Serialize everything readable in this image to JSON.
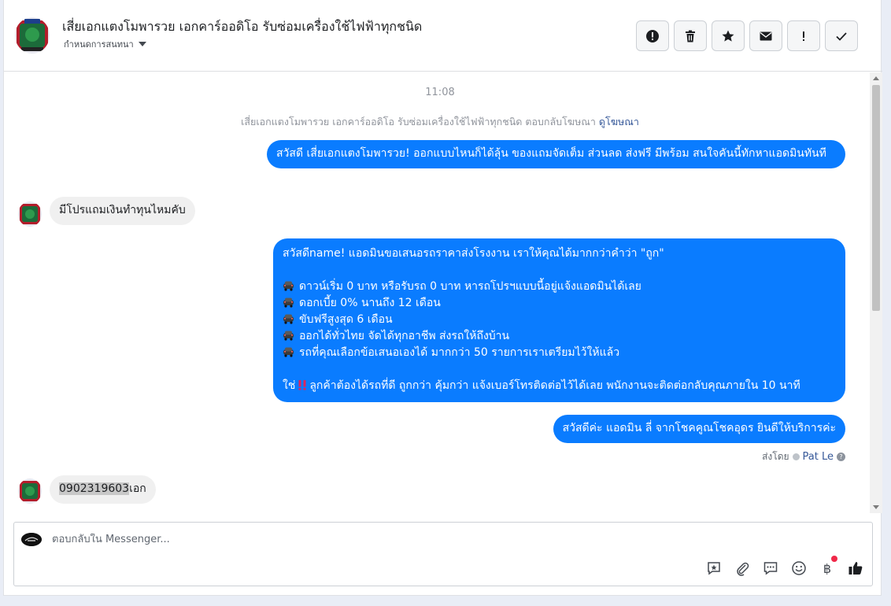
{
  "header": {
    "title": "เสี่ยเอกแตงโมพารวย เอกคาร์ออดิโอ รับซ่อมเครื่องใช้ไฟฟ้าทุกชนิด",
    "assign_label": "กำหนดการสนทนา",
    "actions": [
      {
        "icon": "alert-circle-icon",
        "label": "Mark as spam"
      },
      {
        "icon": "trash-icon",
        "label": "Delete"
      },
      {
        "icon": "star-icon",
        "label": "Star"
      },
      {
        "icon": "envelope-icon",
        "label": "Mark as unread"
      },
      {
        "icon": "exclamation-icon",
        "label": "Follow up"
      },
      {
        "icon": "checkmark-icon",
        "label": "Mark as done"
      }
    ]
  },
  "thread": {
    "timestamp": "11:08",
    "context_text": "เสี่ยเอกแตงโมพารวย เอกคาร์ออดิโอ รับซ่อมเครื่องใช้ไฟฟ้าทุกชนิด ตอบกลับโฆษณา",
    "context_link": "ดูโฆษณา",
    "messages": [
      {
        "direction": "out",
        "text": "สวัสดี เสี่ยเอกแตงโมพารวย! ออกแบบไหนก็ได้ลุ้น ของแถมจัดเต็ม ส่วนลด ส่งฟรี มีพร้อม สนใจคันนี้ทักหาแอดมินทันที"
      },
      {
        "direction": "in",
        "text": "มีโปรแถมเงินทำทุนไหมคับ"
      },
      {
        "direction": "out",
        "lines": [
          "สวัสดีname! แอดมินขอเสนอรถราคาส่งโรงงาน เราให้คุณได้มากกว่าคำว่า \"ถูก\"",
          "",
          "ดาวน์เริ่ม 0 บาท หรือรับรถ 0 บาท หารถโปรฯแบบนี้อยู่แจ้งแอดมินได้เลย",
          "ดอกเบี้ย 0% นานถึง 12 เดือน",
          "ขับฟรีสูงสุด 6 เดือน",
          "ออกได้ทั่วไทย จัดได้ทุกอาชีพ ส่งรถให้ถึงบ้าน",
          "รถที่คุณเลือกข้อเสนอเองได้ มากกว่า 50 รายการเราเตรียมไว้ให้แล้ว",
          "",
          "ลูกค้าต้องได้รถที่ดี ถูกกว่า คุ้มกว่า แจ้งเบอร์โทรติดต่อไว้ได้เลย พนักงานจะติดต่อกลับคุณภายใน 10 นาที"
        ],
        "last_line_prefix": "ใช่"
      },
      {
        "direction": "out",
        "text": "สวัสดีค่ะ แอดมิน ลี่ จากโชคคูณโชคอุดร ยินดีให้บริการค่ะ"
      },
      {
        "direction": "in",
        "text_highlight": "0902319603",
        "text_rest": "เอก"
      }
    ],
    "sent_by_label": "ส่งโดย",
    "sent_by_name": "Pat Le"
  },
  "composer": {
    "placeholder": "ตอบกลับใน Messenger...",
    "tools": [
      "saved-reply-icon",
      "attachment-icon",
      "chat-bubble-icon",
      "emoji-icon",
      "baht-payment-icon",
      "thumbs-up-icon"
    ]
  },
  "colors": {
    "outgoing_bubble": "#0a7cff",
    "incoming_bubble": "#f0f0f0",
    "link": "#365899",
    "notification_dot": "#f02849"
  }
}
